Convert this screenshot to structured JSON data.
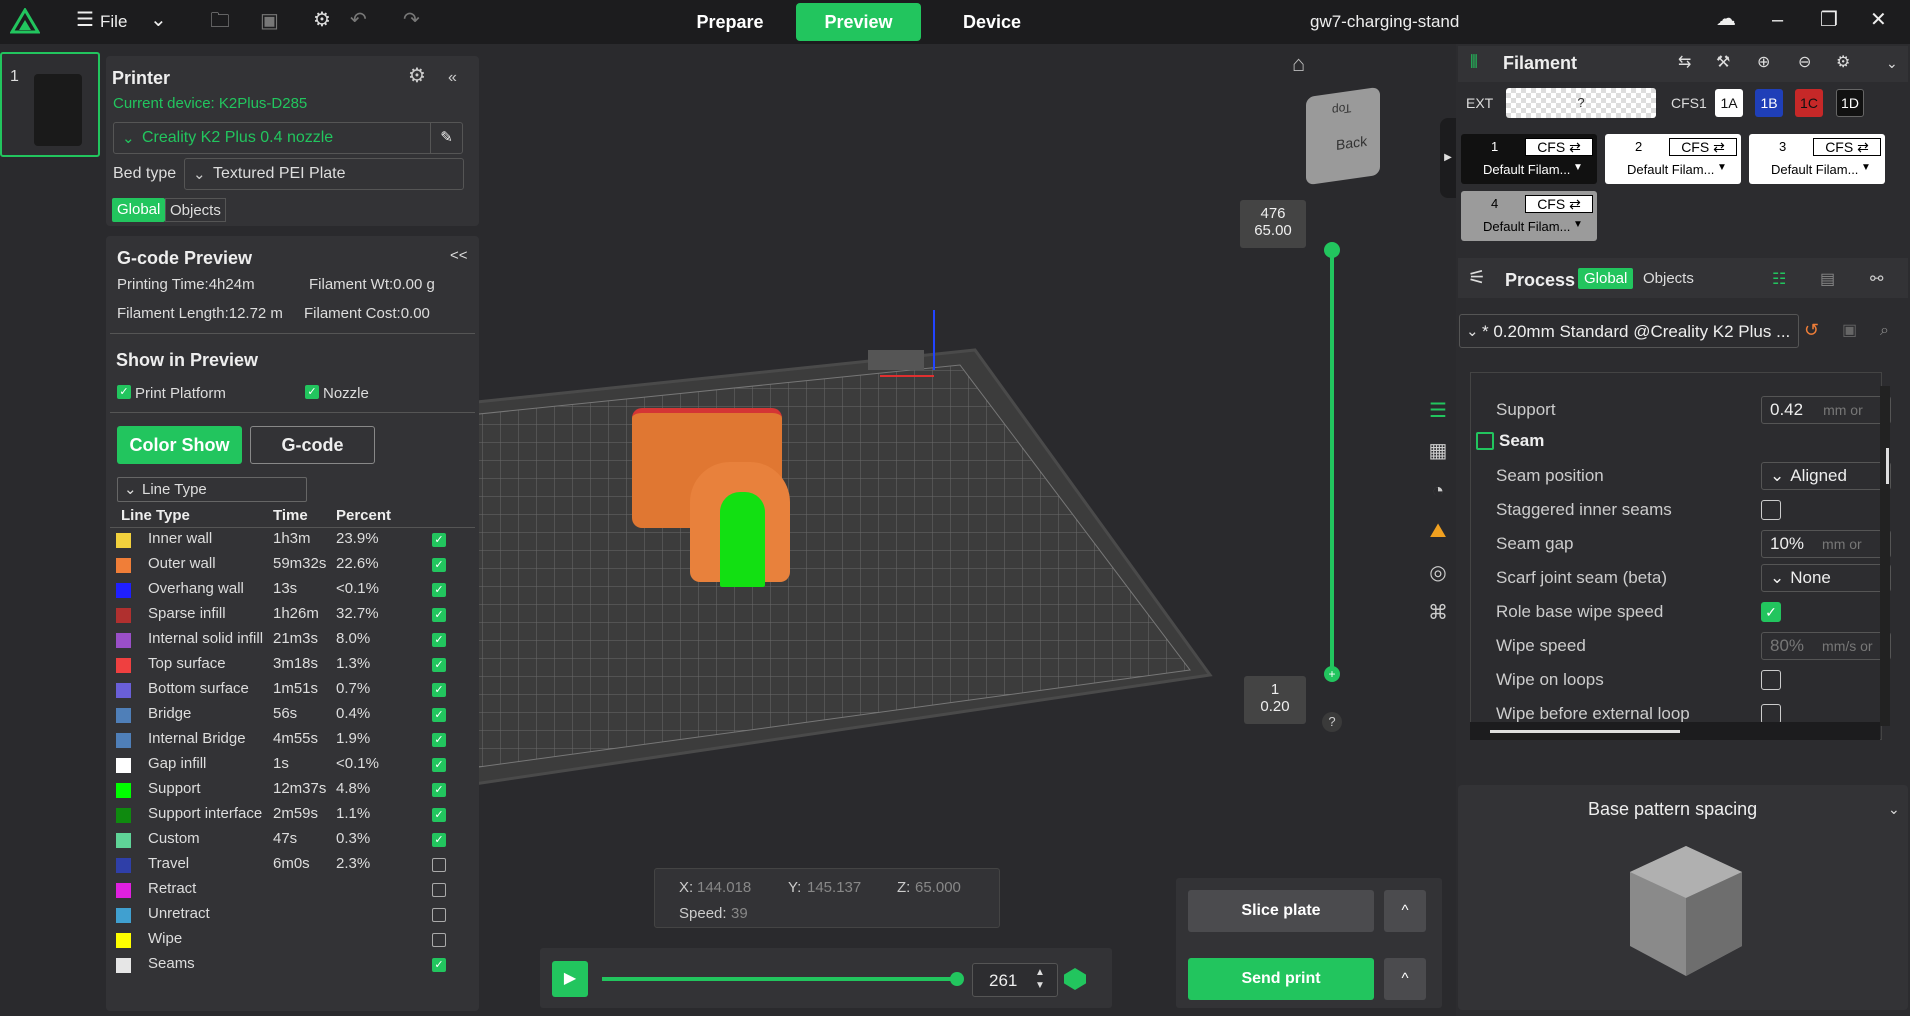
{
  "topbar": {
    "file_label": "File",
    "tabs": [
      "Prepare",
      "Preview",
      "Device"
    ],
    "project_title": "gw7-charging-stand"
  },
  "plate": {
    "number": "1"
  },
  "printer": {
    "title": "Printer",
    "current_device": "Current device: K2Plus-D285",
    "preset": "Creality K2 Plus 0.4 nozzle",
    "bed_type_label": "Bed type",
    "bed_type_value": "Textured PEI Plate",
    "global_tab": "Global",
    "objects_tab": "Objects"
  },
  "gcode": {
    "title": "G-code Preview",
    "collapse": "<<",
    "printing_time": "Printing Time:4h24m",
    "filament_wt": "Filament Wt:0.00 g",
    "filament_length": "Filament Length:12.72 m",
    "filament_cost": "Filament Cost:0.00",
    "show_title": "Show in Preview",
    "print_platform": "Print Platform",
    "nozzle": "Nozzle",
    "color_show": "Color Show",
    "gcode_btn": "G-code",
    "view_type": "Line Type",
    "col_type": "Line Type",
    "col_time": "Time",
    "col_percent": "Percent"
  },
  "legend": [
    {
      "name": "Inner wall",
      "time": "1h3m",
      "pct": "23.9%",
      "color": "#f2d13d",
      "on": true
    },
    {
      "name": "Outer wall",
      "time": "59m32s",
      "pct": "22.6%",
      "color": "#f07e38",
      "on": true
    },
    {
      "name": "Overhang wall",
      "time": "13s",
      "pct": "<0.1%",
      "color": "#1f1fff",
      "on": true
    },
    {
      "name": "Sparse infill",
      "time": "1h26m",
      "pct": "32.7%",
      "color": "#b0302f",
      "on": true
    },
    {
      "name": "Internal solid infill",
      "time": "21m3s",
      "pct": "8.0%",
      "color": "#9a4fc8",
      "on": true
    },
    {
      "name": "Top surface",
      "time": "3m18s",
      "pct": "1.3%",
      "color": "#ef4040",
      "on": true
    },
    {
      "name": "Bottom surface",
      "time": "1m51s",
      "pct": "0.7%",
      "color": "#6a5fd8",
      "on": true
    },
    {
      "name": "Bridge",
      "time": "56s",
      "pct": "0.4%",
      "color": "#4f7fb8",
      "on": true
    },
    {
      "name": "Internal Bridge",
      "time": "4m55s",
      "pct": "1.9%",
      "color": "#4f7fb8",
      "on": true
    },
    {
      "name": "Gap infill",
      "time": "1s",
      "pct": "<0.1%",
      "color": "#ffffff",
      "on": true
    },
    {
      "name": "Support",
      "time": "12m37s",
      "pct": "4.8%",
      "color": "#00ff00",
      "on": true
    },
    {
      "name": "Support interface",
      "time": "2m59s",
      "pct": "1.1%",
      "color": "#0f8a0f",
      "on": true
    },
    {
      "name": "Custom",
      "time": "47s",
      "pct": "0.3%",
      "color": "#5fd497",
      "on": true
    },
    {
      "name": "Travel",
      "time": "6m0s",
      "pct": "2.3%",
      "color": "#2f3fa8",
      "on": false
    },
    {
      "name": "Retract",
      "time": "",
      "pct": "",
      "color": "#e020e0",
      "on": false
    },
    {
      "name": "Unretract",
      "time": "",
      "pct": "",
      "color": "#40a0d0",
      "on": false
    },
    {
      "name": "Wipe",
      "time": "",
      "pct": "",
      "color": "#ffff00",
      "on": false
    },
    {
      "name": "Seams",
      "time": "",
      "pct": "",
      "color": "#e6e6e6",
      "on": true
    }
  ],
  "layer_slider": {
    "top_layer": "476",
    "top_height": "65.00",
    "bottom_layer": "1",
    "bottom_height": "0.20",
    "help": "?"
  },
  "view_cube": {
    "top": "Top",
    "back": "Back"
  },
  "coords": {
    "x_label": "X:",
    "x": "144.018",
    "y_label": "Y:",
    "y": "145.137",
    "z_label": "Z:",
    "z": "65.000",
    "speed_label": "Speed:",
    "speed": "39"
  },
  "playback": {
    "value": "261",
    "progress": 1.0
  },
  "actions": {
    "slice": "Slice plate",
    "send": "Send print",
    "caret": "^"
  },
  "filament": {
    "title": "Filament",
    "ext": "EXT",
    "ext_value": "?",
    "cfs1": "CFS1",
    "chips": [
      "1A",
      "1B",
      "1C",
      "1D"
    ],
    "slots": [
      {
        "n": "1",
        "label": "Default Filam..."
      },
      {
        "n": "2",
        "label": "Default Filam..."
      },
      {
        "n": "3",
        "label": "Default Filam..."
      },
      {
        "n": "4",
        "label": "Default Filam..."
      }
    ],
    "cfs": "CFS ⇄"
  },
  "process": {
    "title": "Process",
    "global": "Global",
    "objects": "Objects",
    "preset": "* 0.20mm Standard @Creality K2 Plus ...",
    "support_label": "Support",
    "support_value": "0.42",
    "support_unit": "mm or",
    "seam_title": "Seam",
    "rows": [
      {
        "label": "Seam position",
        "type": "select",
        "value": "Aligned"
      },
      {
        "label": "Staggered inner seams",
        "type": "check",
        "value": false
      },
      {
        "label": "Seam gap",
        "type": "input",
        "value": "10%",
        "unit": "mm or"
      },
      {
        "label": "Scarf joint seam (beta)",
        "type": "select",
        "value": "None"
      },
      {
        "label": "Role base wipe speed",
        "type": "check",
        "value": true
      },
      {
        "label": "Wipe speed",
        "type": "input",
        "value": "80%",
        "unit": "mm/s or"
      },
      {
        "label": "Wipe on loops",
        "type": "check",
        "value": false
      },
      {
        "label": "Wipe before external loop",
        "type": "check",
        "value": false
      }
    ]
  },
  "tip": {
    "title": "Base pattern spacing"
  }
}
